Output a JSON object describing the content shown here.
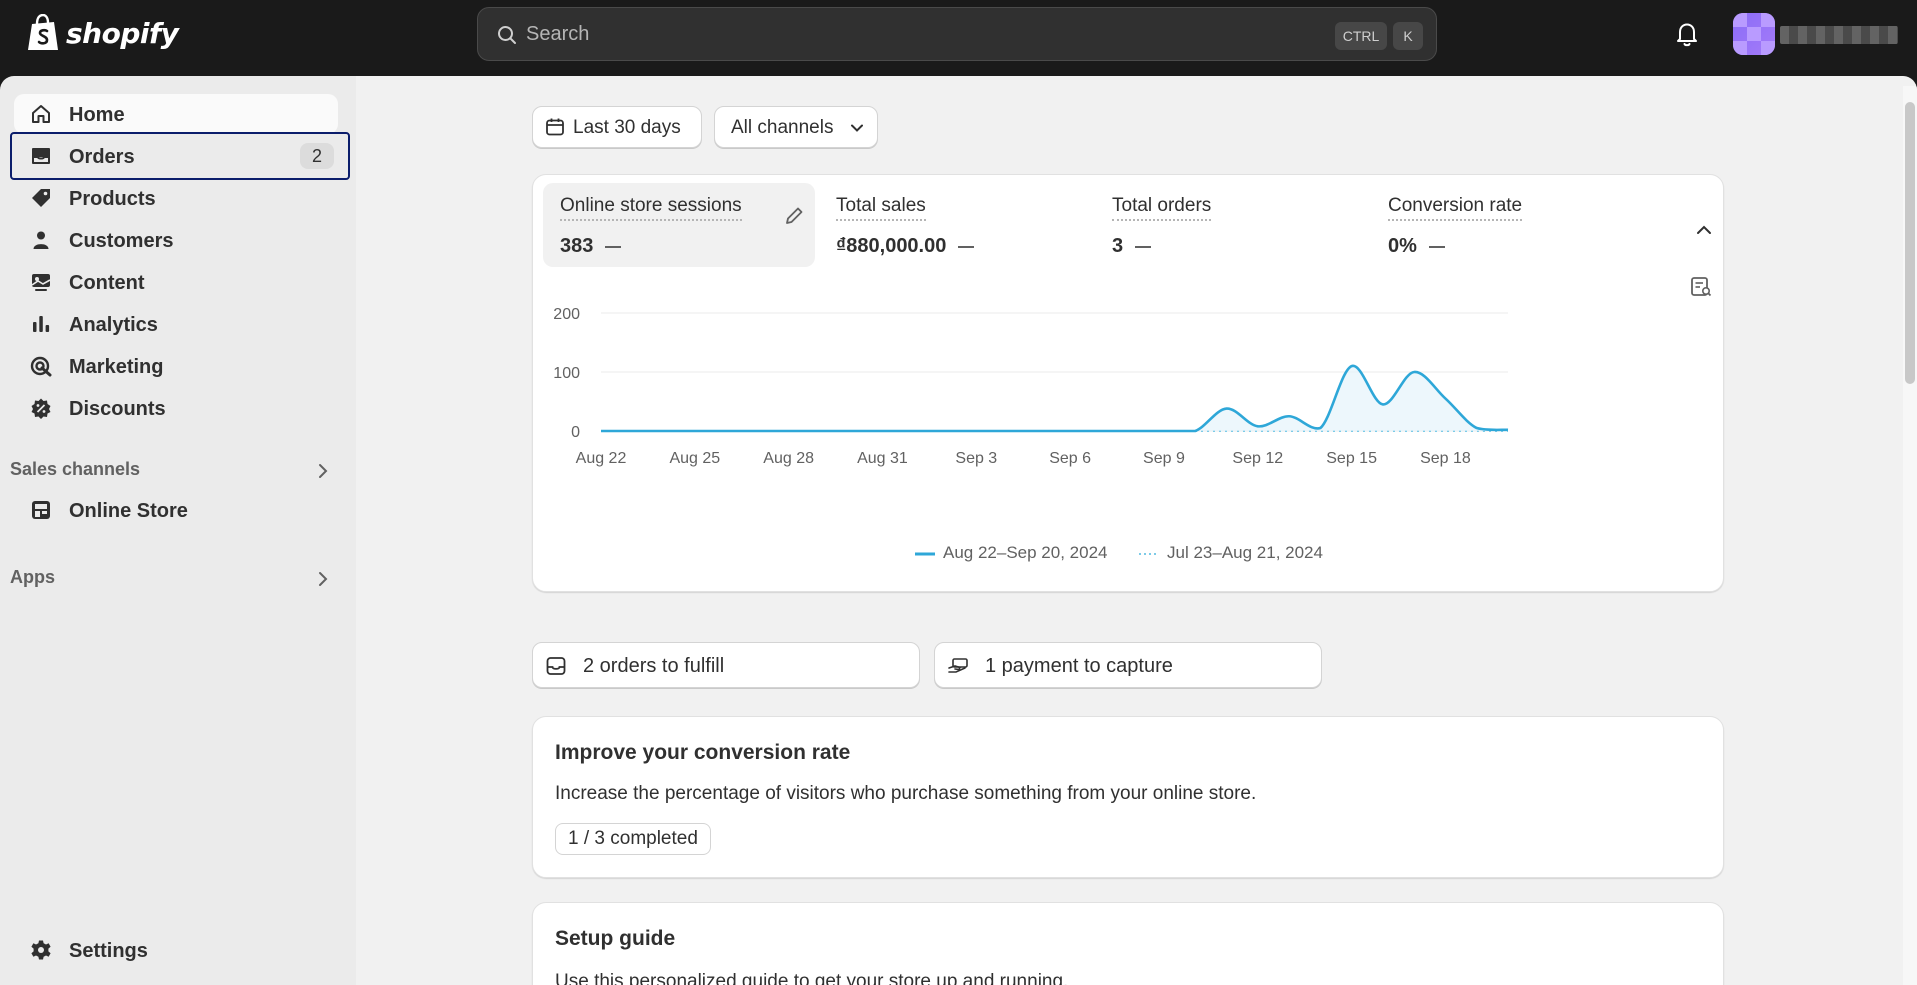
{
  "brand": {
    "name": "shopify"
  },
  "search": {
    "placeholder": "Search",
    "shortcut_ctrl": "CTRL",
    "shortcut_key": "K"
  },
  "sidebar": {
    "items": [
      {
        "label": "Home",
        "icon": "home-icon"
      },
      {
        "label": "Orders",
        "icon": "orders-icon",
        "badge": "2"
      },
      {
        "label": "Products",
        "icon": "tag-icon"
      },
      {
        "label": "Customers",
        "icon": "person-icon"
      },
      {
        "label": "Content",
        "icon": "content-icon"
      },
      {
        "label": "Analytics",
        "icon": "bar-chart-icon"
      },
      {
        "label": "Marketing",
        "icon": "target-icon"
      },
      {
        "label": "Discounts",
        "icon": "discount-icon"
      }
    ],
    "sales_channels": {
      "title": "Sales channels",
      "items": [
        {
          "label": "Online Store",
          "icon": "store-icon"
        }
      ]
    },
    "apps": {
      "title": "Apps"
    },
    "settings": {
      "label": "Settings",
      "icon": "gear-icon"
    }
  },
  "filters": {
    "date_range": "Last 30 days",
    "channels": "All channels"
  },
  "metrics": [
    {
      "label": "Online store sessions",
      "value": "383"
    },
    {
      "label": "Total sales",
      "value": "₫880,000.00"
    },
    {
      "label": "Total orders",
      "value": "3"
    },
    {
      "label": "Conversion rate",
      "value": "0%"
    }
  ],
  "chart_data": {
    "type": "line",
    "title": "",
    "xlabel": "",
    "ylabel": "",
    "x": [
      "Aug 22",
      "Aug 23",
      "Aug 24",
      "Aug 25",
      "Aug 26",
      "Aug 27",
      "Aug 28",
      "Aug 29",
      "Aug 30",
      "Aug 31",
      "Sep 1",
      "Sep 2",
      "Sep 3",
      "Sep 4",
      "Sep 5",
      "Sep 6",
      "Sep 7",
      "Sep 8",
      "Sep 9",
      "Sep 10",
      "Sep 11",
      "Sep 12",
      "Sep 13",
      "Sep 14",
      "Sep 15",
      "Sep 16",
      "Sep 17",
      "Sep 18",
      "Sep 19",
      "Sep 20"
    ],
    "x_ticks": [
      "Aug 22",
      "Aug 25",
      "Aug 28",
      "Aug 31",
      "Sep 3",
      "Sep 6",
      "Sep 9",
      "Sep 12",
      "Sep 15",
      "Sep 18"
    ],
    "y_ticks": [
      0,
      100,
      200
    ],
    "ylim": [
      0,
      200
    ],
    "grid": true,
    "legend_position": "bottom-center",
    "series": [
      {
        "name": "Aug 22–Sep 20, 2024",
        "style": "solid",
        "color": "#2ea7d8",
        "values": [
          0,
          0,
          0,
          0,
          0,
          0,
          0,
          0,
          0,
          0,
          0,
          0,
          0,
          0,
          0,
          0,
          0,
          0,
          0,
          0,
          38,
          8,
          25,
          5,
          110,
          45,
          100,
          55,
          5,
          2
        ]
      },
      {
        "name": "Jul 23–Aug 21, 2024",
        "style": "dotted",
        "color": "#7dcbe8",
        "values": [
          0,
          0,
          0,
          0,
          0,
          0,
          0,
          0,
          0,
          0,
          0,
          0,
          0,
          0,
          0,
          0,
          0,
          0,
          0,
          0,
          0,
          0,
          0,
          0,
          0,
          0,
          0,
          0,
          0,
          0
        ]
      }
    ]
  },
  "tasks": [
    {
      "label": "2 orders to fulfill",
      "icon": "inbox-icon"
    },
    {
      "label": "1 payment to capture",
      "icon": "hand-money-icon"
    }
  ],
  "conversion_card": {
    "title": "Improve your conversion rate",
    "text": "Increase the percentage of visitors who purchase something from your online store.",
    "progress": "1 / 3 completed"
  },
  "setup_card": {
    "title": "Setup guide",
    "text": "Use this personalized guide to get your store up and running."
  }
}
